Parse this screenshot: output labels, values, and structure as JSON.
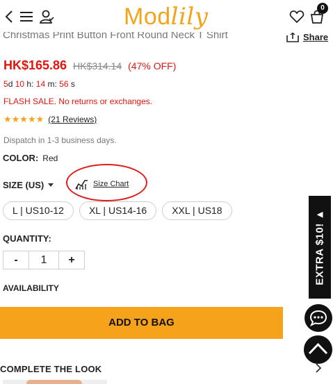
{
  "header": {
    "logo_part1": "Mod",
    "logo_part2": "lily",
    "cart_count": "0",
    "icons": [
      "back-icon",
      "menu-icon",
      "account-icon",
      "heart-icon",
      "bag-icon"
    ]
  },
  "product": {
    "title": "Christmas Print Button Front Round Neck T Shirt",
    "share_label": "Share",
    "price": "HK$165.86",
    "original_price": "HK$314.14",
    "discount": "(47% OFF)",
    "countdown": {
      "days": "5",
      "d_label": "d",
      "hours": "10",
      "h_label": "h:",
      "minutes": "14",
      "m_label": "m:",
      "seconds": "56",
      "s_label": "s"
    },
    "flash_note": "FLASH SALE. No returns or exchanges.",
    "stars": "★★★★★",
    "rating_value": 5,
    "reviews": "(21 Reviews)",
    "dispatch": "Dispatch in 1-3 business days.",
    "color_label": "COLOR:",
    "color_value": "Red",
    "size_label": "SIZE (US)",
    "size_chart_label": "Size Chart",
    "sizes": [
      "L | US10-12",
      "XL | US14-16",
      "XXL | US18"
    ],
    "quantity_label": "QUANTITY:",
    "qty_minus": "-",
    "qty_value": "1",
    "qty_plus": "+",
    "availability_label": "AVAILABILITY",
    "add_to_bag": "ADD TO BAG"
  },
  "floating": {
    "extra_label": "EXTRA $10! ▲"
  },
  "complete_look": {
    "label": "COMPLETE THE LOOK"
  },
  "colors": {
    "accent": "#f7a21b",
    "sale_red": "#e2150d",
    "annotation_circle": "#e01d1d"
  }
}
